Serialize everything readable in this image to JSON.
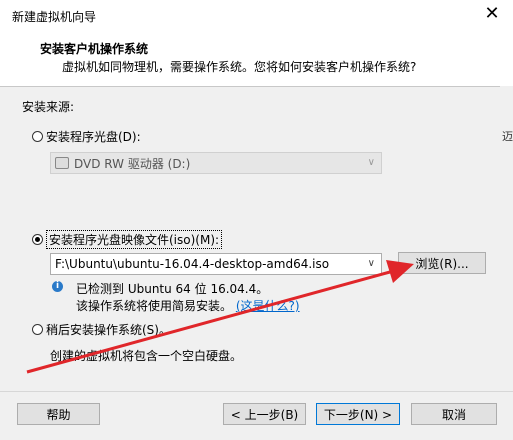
{
  "window": {
    "title": "新建虚拟机向导",
    "close_glyph": "✕"
  },
  "header": {
    "title": "安装客户机操作系统",
    "subtitle": "虚拟机如同物理机，需要操作系统。您将如何安装客户机操作系统?"
  },
  "source_label": "安装来源:",
  "options": {
    "disc": {
      "label": "安装程序光盘(D):",
      "selected": false,
      "drive": "DVD RW 驱动器 (D:)"
    },
    "iso": {
      "label": "安装程序光盘映像文件(iso)(M):",
      "selected": true,
      "path": "F:\\Ubuntu\\ubuntu-16.04.4-desktop-amd64.iso",
      "browse_label": "浏览(R)..."
    },
    "detect": {
      "line1": "已检测到 Ubuntu 64 位 16.04.4。",
      "line2_prefix": "该操作系统将使用简易安装。",
      "link": "(这是什么?)"
    },
    "later": {
      "label": "稍后安装操作系统(S)。",
      "selected": false,
      "desc": "创建的虚拟机将包含一个空白硬盘。"
    }
  },
  "buttons": {
    "help": "帮助",
    "back": "< 上一步(B)",
    "next": "下一步(N) >",
    "cancel": "取消"
  },
  "side_fragment": "迈",
  "colors": {
    "arrow": "#e0262a",
    "link": "#0066cc",
    "primary_border": "#0078d7"
  }
}
